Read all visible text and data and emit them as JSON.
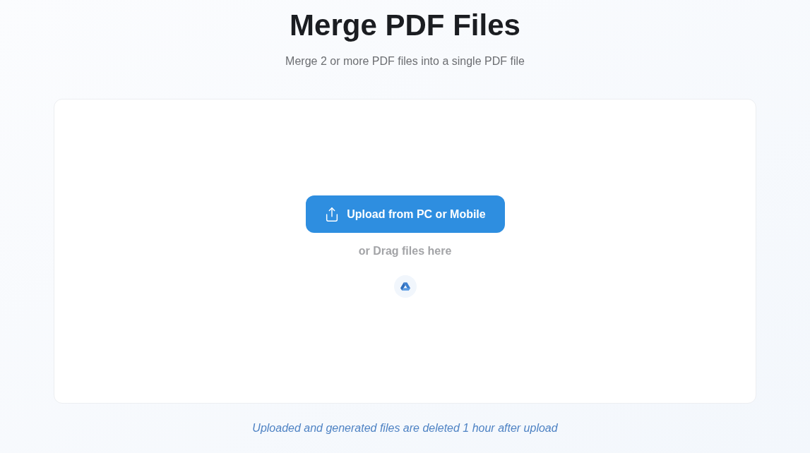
{
  "page": {
    "title": "Merge PDF Files",
    "subtitle": "Merge 2 or more PDF files into a single PDF file"
  },
  "upload_area": {
    "upload_button": "Upload from PC or Mobile",
    "drag_hint": "or Drag files here"
  },
  "footer_note": "Uploaded and generated files are deleted 1 hour after upload"
}
